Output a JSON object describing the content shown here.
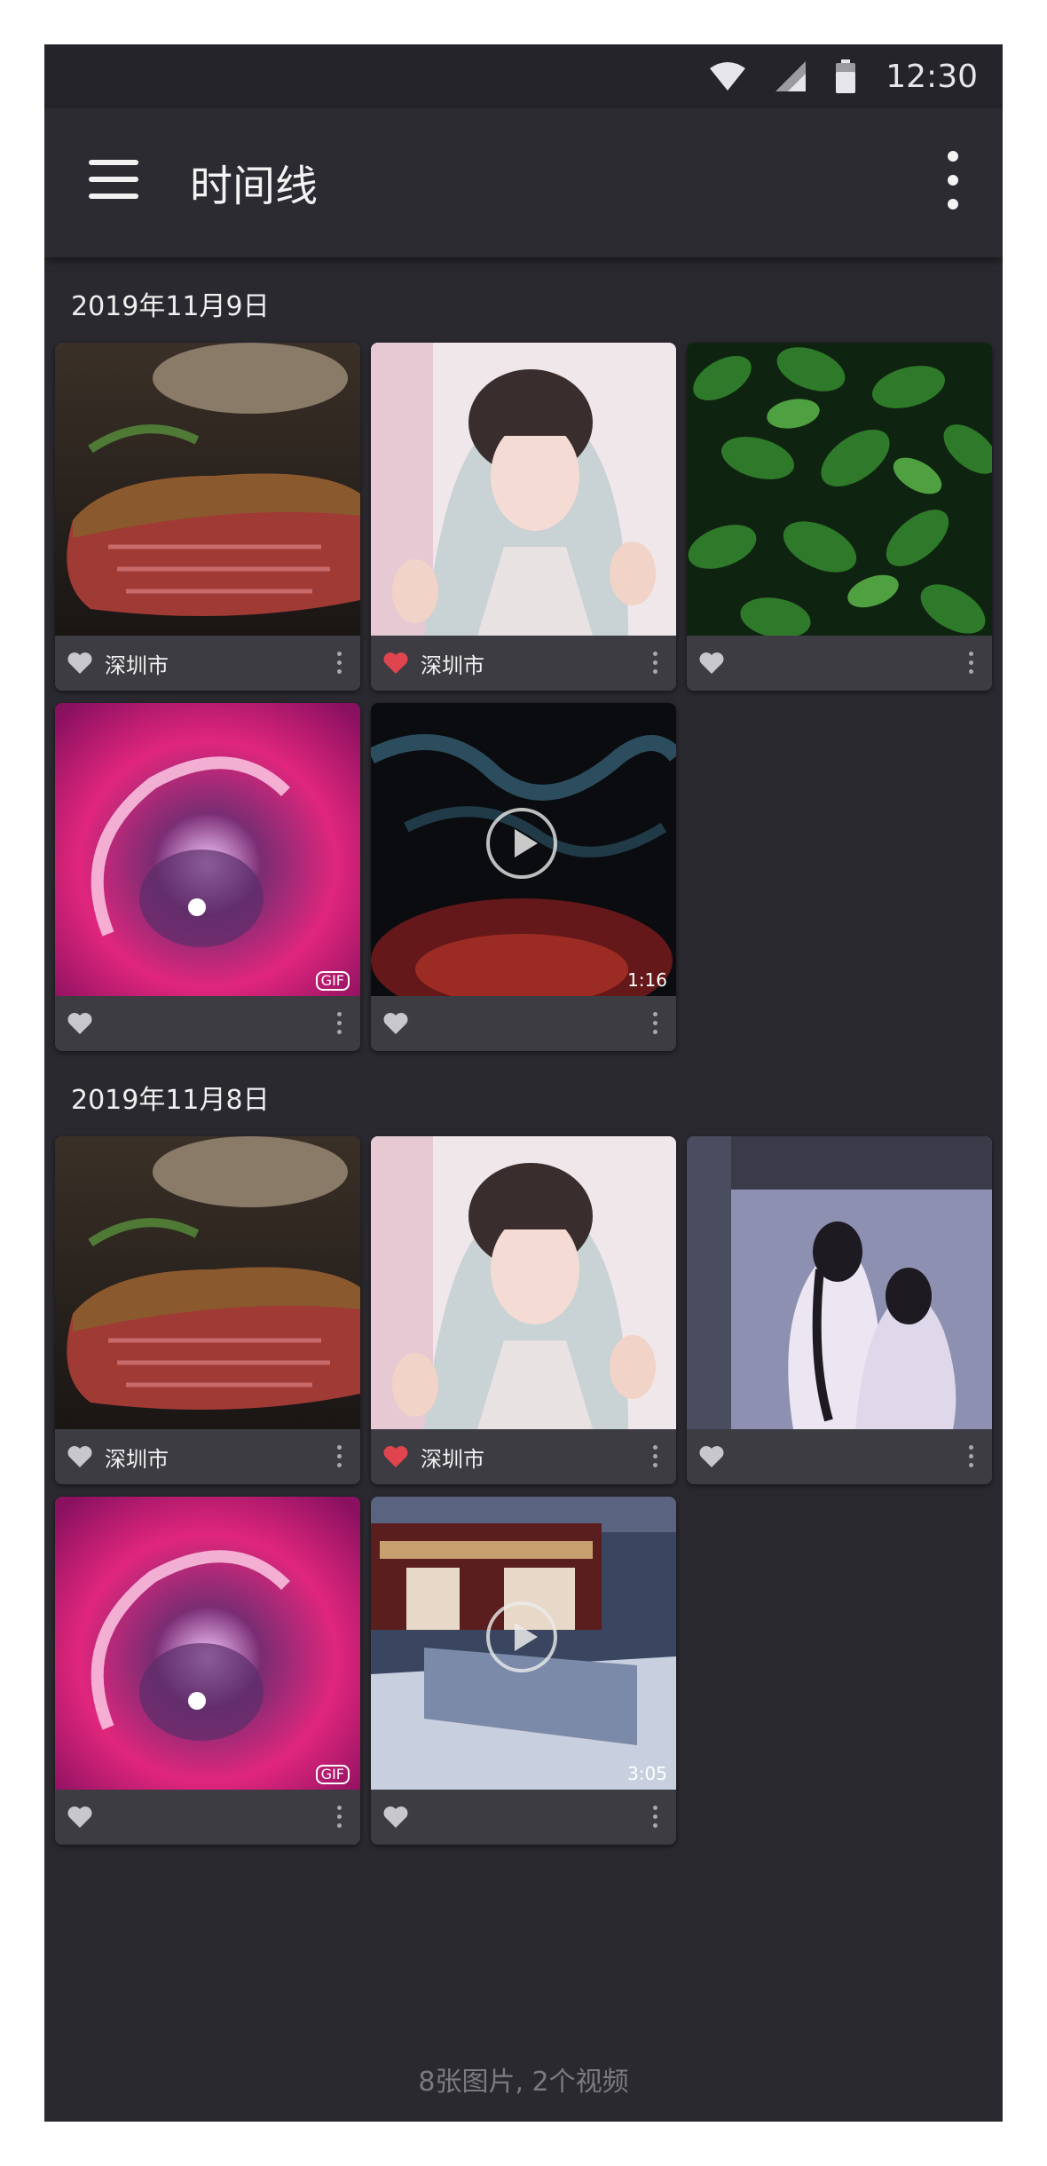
{
  "status": {
    "time": "12:30"
  },
  "appbar": {
    "title": "时间线"
  },
  "sections": [
    {
      "date": "2019年11月9日",
      "items": [
        {
          "kind": "photo",
          "image": "steak",
          "liked": false,
          "location": "深圳市"
        },
        {
          "kind": "photo",
          "image": "girl-hanfu",
          "liked": true,
          "location": "深圳市"
        },
        {
          "kind": "photo",
          "image": "green-leaves",
          "liked": false,
          "location": ""
        },
        {
          "kind": "gif",
          "image": "pink-swirl",
          "liked": false,
          "badge": "GIF"
        },
        {
          "kind": "video",
          "image": "smoke-ink",
          "liked": false,
          "duration": "1:16"
        }
      ]
    },
    {
      "date": "2019年11月8日",
      "items": [
        {
          "kind": "photo",
          "image": "steak",
          "liked": false,
          "location": "深圳市"
        },
        {
          "kind": "photo",
          "image": "girl-hanfu",
          "liked": true,
          "location": "深圳市"
        },
        {
          "kind": "photo",
          "image": "anime-couple",
          "liked": false,
          "location": ""
        },
        {
          "kind": "gif",
          "image": "pink-swirl",
          "liked": false,
          "badge": "GIF"
        },
        {
          "kind": "video",
          "image": "palace-night",
          "liked": false,
          "duration": "3:05"
        }
      ]
    }
  ],
  "footer": {
    "summary": "8张图片, 2个视频"
  },
  "colors": {
    "background": "#2a292f",
    "appbar": "#2c2b31",
    "heart_liked": "#e0454f",
    "heart_default": "#c8c7cc"
  }
}
